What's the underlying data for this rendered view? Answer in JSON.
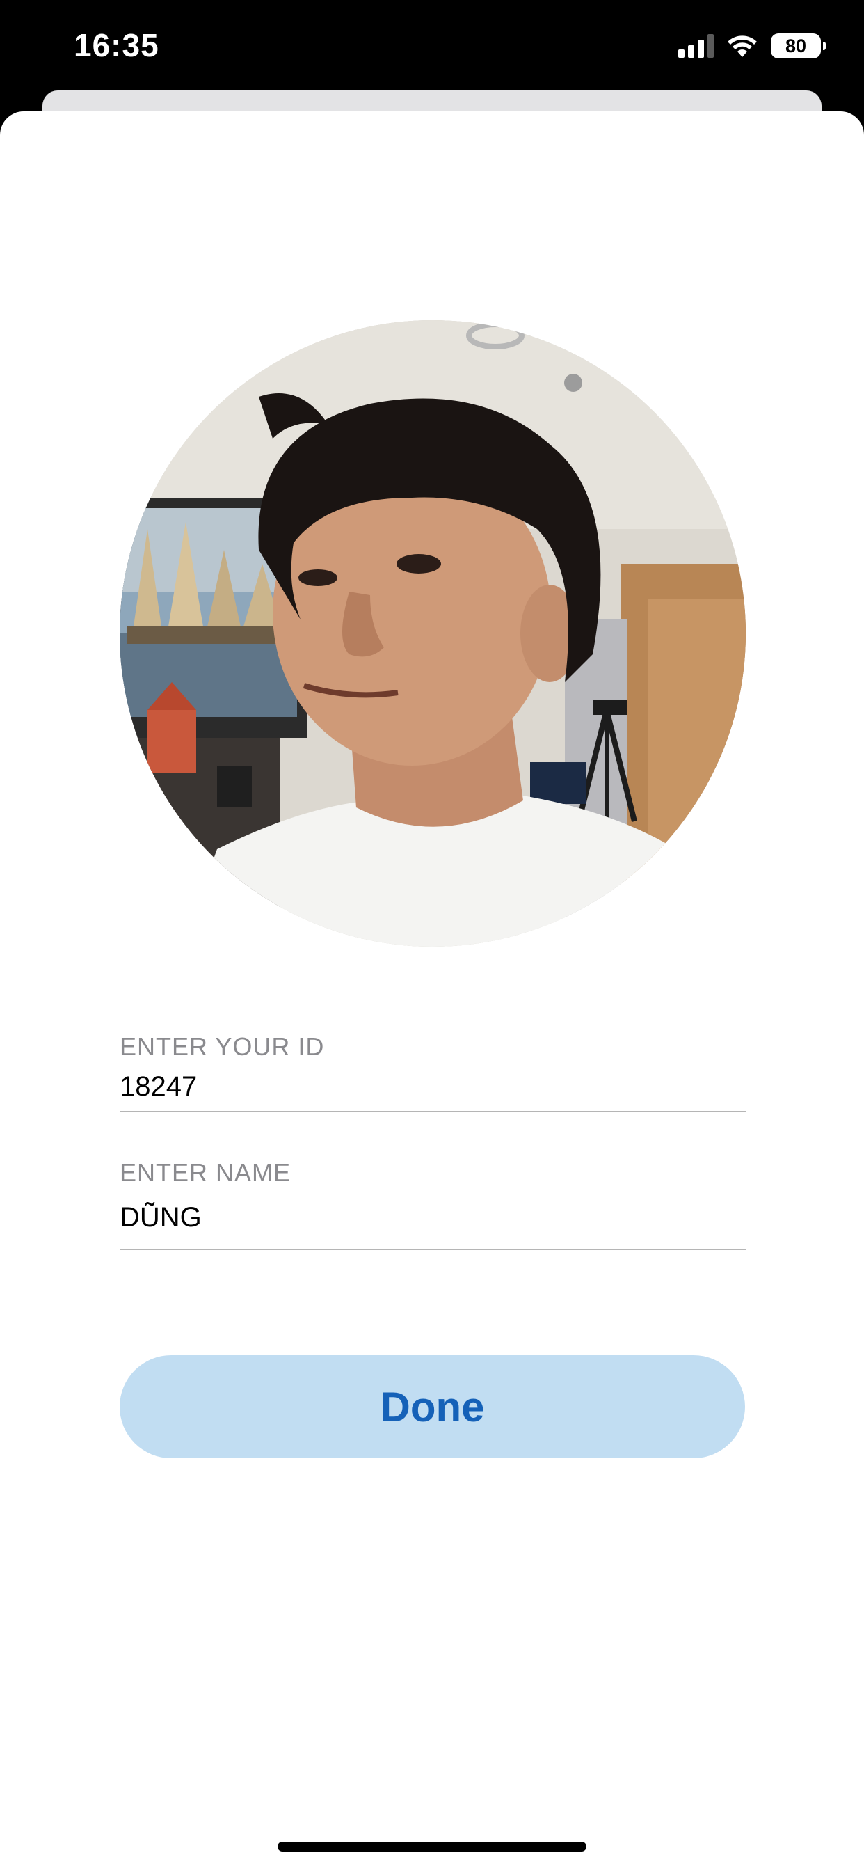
{
  "status_bar": {
    "time": "16:35",
    "battery_level": "80",
    "signal_bars_active": 3,
    "signal_bars_total": 4,
    "icons": [
      "cellular-signal-icon",
      "wifi-icon",
      "battery-icon"
    ]
  },
  "profile": {
    "photo": "profile-photo"
  },
  "form": {
    "id_label": "ENTER YOUR ID",
    "id_value": "18247",
    "name_label": "ENTER NAME",
    "name_value": "DŨNG"
  },
  "actions": {
    "done_label": "Done"
  },
  "colors": {
    "button_background": "#c1ddf2",
    "button_text": "#1561b8",
    "label_text": "#8a8a8e",
    "divider": "#b5b5b5"
  }
}
